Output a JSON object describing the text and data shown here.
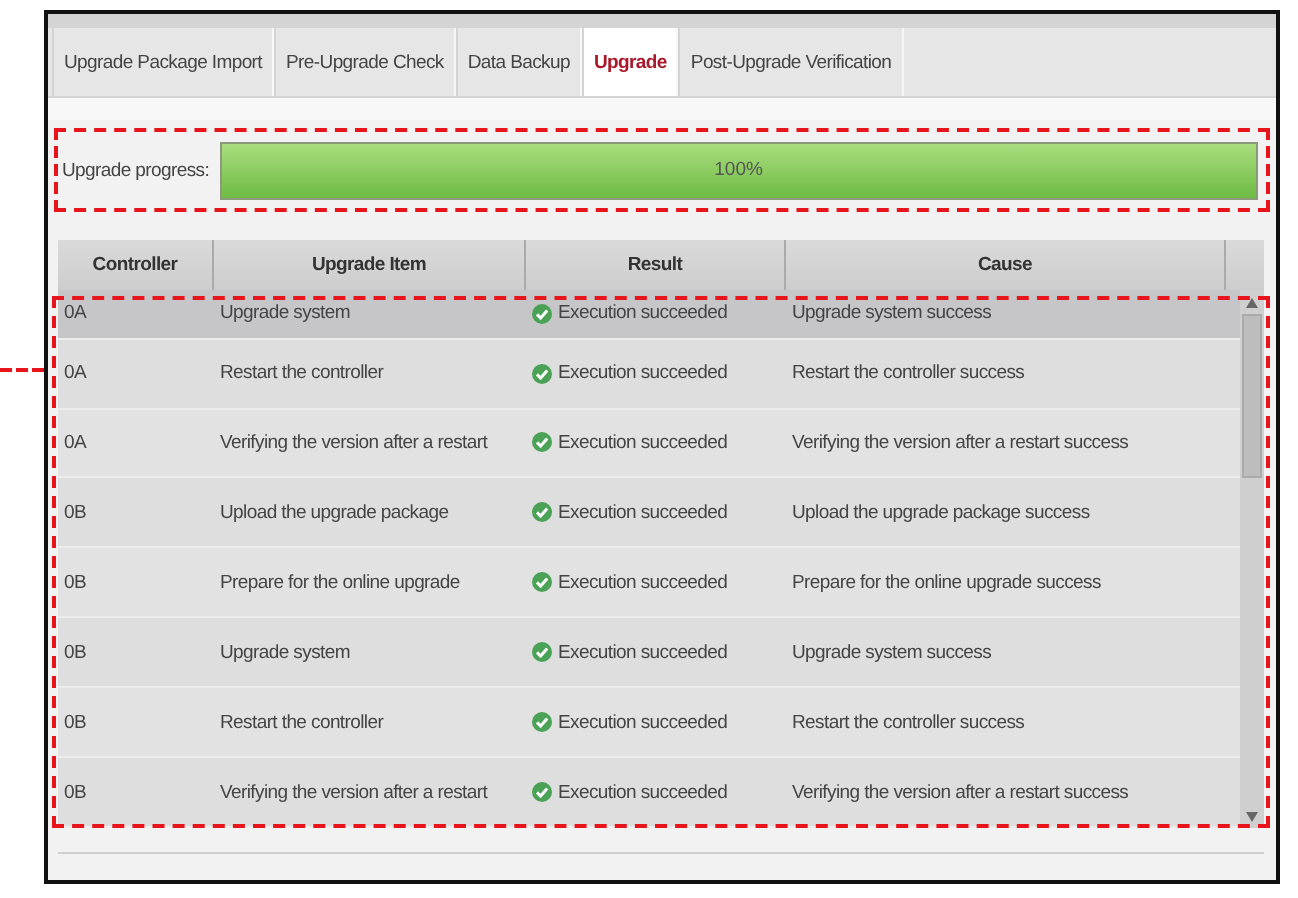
{
  "tabs": [
    {
      "label": "Upgrade Package Import",
      "selected": false
    },
    {
      "label": "Pre-Upgrade Check",
      "selected": false
    },
    {
      "label": "Data Backup",
      "selected": false
    },
    {
      "label": "Upgrade",
      "selected": true
    },
    {
      "label": "Post-Upgrade Verification",
      "selected": false
    }
  ],
  "progress": {
    "label": "Upgrade progress:",
    "level": 1,
    "reading": "100%"
  },
  "table": {
    "columns": [
      "Controller",
      "Upgrade Item",
      "Result",
      "Cause"
    ],
    "rows": [
      {
        "controller": "0A",
        "item": "Upgrade system",
        "result": "Execution succeeded",
        "cause": "Upgrade system success",
        "selected": true
      },
      {
        "controller": "0A",
        "item": "Restart the controller",
        "result": "Execution succeeded",
        "cause": "Restart the controller success",
        "selected": false
      },
      {
        "controller": "0A",
        "item": "Verifying the version after a restart",
        "result": "Execution succeeded",
        "cause": "Verifying the version after a restart success",
        "selected": false
      },
      {
        "controller": "0B",
        "item": "Upload the upgrade package",
        "result": "Execution succeeded",
        "cause": "Upload the upgrade package success",
        "selected": false
      },
      {
        "controller": "0B",
        "item": "Prepare for the online upgrade",
        "result": "Execution succeeded",
        "cause": "Prepare for the online upgrade success",
        "selected": false
      },
      {
        "controller": "0B",
        "item": "Upgrade system",
        "result": "Execution succeeded",
        "cause": "Upgrade system success",
        "selected": false
      },
      {
        "controller": "0B",
        "item": "Restart the controller",
        "result": "Execution succeeded",
        "cause": "Restart the controller success",
        "selected": false
      },
      {
        "controller": "0B",
        "item": "Verifying the version after a restart",
        "result": "Execution succeeded",
        "cause": "Verifying the version after a restart success",
        "selected": false
      }
    ]
  }
}
